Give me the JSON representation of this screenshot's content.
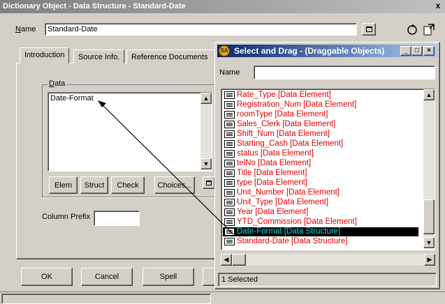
{
  "main_window": {
    "title": "Dictionary Object - Data Structure - Standard-Date",
    "close_glyph": "x",
    "name_label": "Name",
    "name_value": "Standard-Date",
    "tabs": [
      {
        "label": "Introduction"
      },
      {
        "label": "Source Info."
      },
      {
        "label": "Reference Documents"
      }
    ],
    "data_group_label": "Data",
    "data_list": [
      "Date-Format"
    ],
    "data_buttons": [
      "Elem",
      "Struct",
      "Check",
      "Choices..."
    ],
    "column_prefix_label": "Column Prefix",
    "column_prefix_value": "",
    "bottom_buttons": [
      "OK",
      "Cancel",
      "Spell"
    ]
  },
  "popup": {
    "badge": "SA",
    "title": "Select and Drag - (Draggable Objects)",
    "name_label": "Name",
    "name_value": "",
    "items": [
      {
        "label": "Rate_Type  [Data Element]",
        "selected": false
      },
      {
        "label": "Registration_Num  [Data Element]",
        "selected": false
      },
      {
        "label": "roomType  [Data Element]",
        "selected": false
      },
      {
        "label": "Sales_Clerk  [Data Element]",
        "selected": false
      },
      {
        "label": "Shift_Num  [Data Element]",
        "selected": false
      },
      {
        "label": "Starting_Cash  [Data Element]",
        "selected": false
      },
      {
        "label": "status  [Data Element]",
        "selected": false
      },
      {
        "label": "telNo  [Data Element]",
        "selected": false
      },
      {
        "label": "Title  [Data Element]",
        "selected": false
      },
      {
        "label": "type  [Data Element]",
        "selected": false
      },
      {
        "label": "Unit_Number  [Data Element]",
        "selected": false
      },
      {
        "label": "Unit_Type  [Data Element]",
        "selected": false
      },
      {
        "label": "Year  [Data Element]",
        "selected": false
      },
      {
        "label": "YTD_Commission  [Data Element]",
        "selected": false
      },
      {
        "label": "Date-Format  [Data Structure]",
        "selected": true
      },
      {
        "label": "Standard-Date  [Data Structure]",
        "selected": false
      }
    ],
    "status": "1 Selected"
  },
  "colors": {
    "item_text": "#e00000",
    "selected_text": "#00e0e0",
    "active_title": "#0a246a"
  }
}
